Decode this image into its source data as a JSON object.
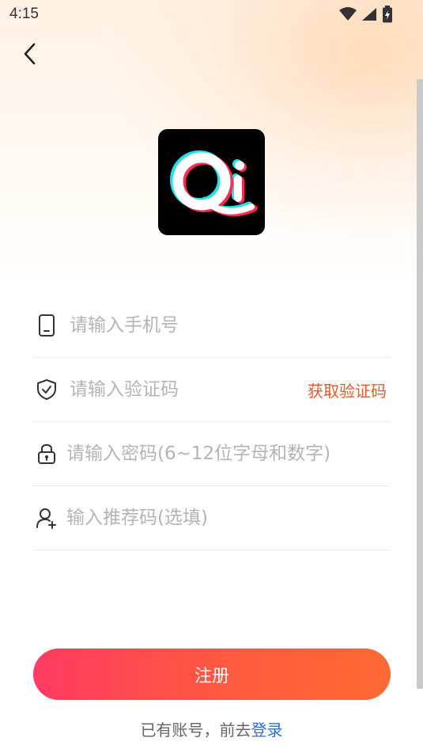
{
  "status_bar": {
    "time": "4:15",
    "icons": [
      "wifi-icon",
      "cellular-signal-icon",
      "battery-charging-icon"
    ]
  },
  "header": {
    "back_icon": "chevron-left-icon"
  },
  "logo": {
    "text": "Qi"
  },
  "form": {
    "phone": {
      "icon": "phone-icon",
      "placeholder": "请输入手机号",
      "value": ""
    },
    "code": {
      "icon": "shield-check-icon",
      "placeholder": "请输入验证码",
      "value": "",
      "action_label": "获取验证码"
    },
    "password": {
      "icon": "lock-icon",
      "placeholder": "请输入密码(6~12位字母和数字)",
      "value": ""
    },
    "referral": {
      "icon": "user-add-icon",
      "placeholder": "输入推荐码(选填)",
      "value": ""
    }
  },
  "submit": {
    "label": "注册"
  },
  "footer": {
    "prompt": "已有账号，前去",
    "login_link": "登录"
  },
  "colors": {
    "accent_start": "#ff3b62",
    "accent_end": "#ff6a33",
    "code_button": "#e55a2a",
    "link": "#2d6fd6"
  }
}
